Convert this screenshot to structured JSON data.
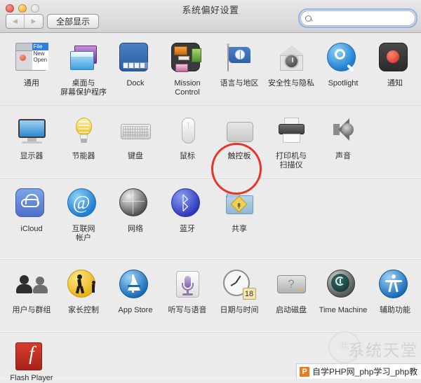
{
  "window": {
    "title": "系统偏好设置",
    "traffic_lights": [
      "close",
      "minimize",
      "zoom"
    ],
    "back_label": "◀",
    "forward_label": "▶",
    "show_all_label": "全部显示"
  },
  "search": {
    "value": "",
    "placeholder": "",
    "icon": "search-icon"
  },
  "rows": [
    {
      "id": "personal",
      "items": [
        {
          "label": "通用",
          "icon": "general-icon"
        },
        {
          "label": "桌面与\n屏幕保护程序",
          "icon": "desktop-screensaver-icon"
        },
        {
          "label": "Dock",
          "icon": "dock-icon"
        },
        {
          "label": "Mission\nControl",
          "icon": "mission-control-icon"
        },
        {
          "label": "语言与地区",
          "icon": "language-region-icon"
        },
        {
          "label": "安全性与隐私",
          "icon": "security-privacy-icon"
        },
        {
          "label": "Spotlight",
          "icon": "spotlight-icon"
        },
        {
          "label": "通知",
          "icon": "notifications-icon"
        }
      ]
    },
    {
      "id": "hardware",
      "items": [
        {
          "label": "显示器",
          "icon": "displays-icon"
        },
        {
          "label": "节能器",
          "icon": "energy-saver-icon"
        },
        {
          "label": "键盘",
          "icon": "keyboard-icon"
        },
        {
          "label": "鼠标",
          "icon": "mouse-icon"
        },
        {
          "label": "触控板",
          "icon": "trackpad-icon",
          "highlighted": true
        },
        {
          "label": "打印机与\n扫描仪",
          "icon": "printers-scanners-icon"
        },
        {
          "label": "声音",
          "icon": "sound-icon"
        }
      ]
    },
    {
      "id": "internet",
      "items": [
        {
          "label": "iCloud",
          "icon": "icloud-icon"
        },
        {
          "label": "互联网\n帐户",
          "icon": "internet-accounts-icon"
        },
        {
          "label": "网络",
          "icon": "network-icon"
        },
        {
          "label": "蓝牙",
          "icon": "bluetooth-icon"
        },
        {
          "label": "共享",
          "icon": "sharing-icon"
        }
      ]
    },
    {
      "id": "system",
      "items": [
        {
          "label": "用户与群组",
          "icon": "users-groups-icon"
        },
        {
          "label": "家长控制",
          "icon": "parental-controls-icon"
        },
        {
          "label": "App Store",
          "icon": "app-store-icon"
        },
        {
          "label": "听写与语音",
          "icon": "dictation-speech-icon"
        },
        {
          "label": "日期与时间",
          "icon": "date-time-icon",
          "badge": "18"
        },
        {
          "label": "启动磁盘",
          "icon": "startup-disk-icon"
        },
        {
          "label": "Time Machine",
          "icon": "time-machine-icon"
        },
        {
          "label": "辅助功能",
          "icon": "accessibility-icon"
        }
      ]
    },
    {
      "id": "other",
      "items": [
        {
          "label": "Flash Player",
          "icon": "flash-player-icon",
          "glyph": "f"
        }
      ]
    }
  ],
  "annotation": {
    "target": "触控板",
    "shape": "circle",
    "color": "#e8352a"
  },
  "watermark": {
    "text": "系统天堂",
    "logo_letter": "P",
    "bottom_text": "自学PHP网_php学习_php教"
  }
}
